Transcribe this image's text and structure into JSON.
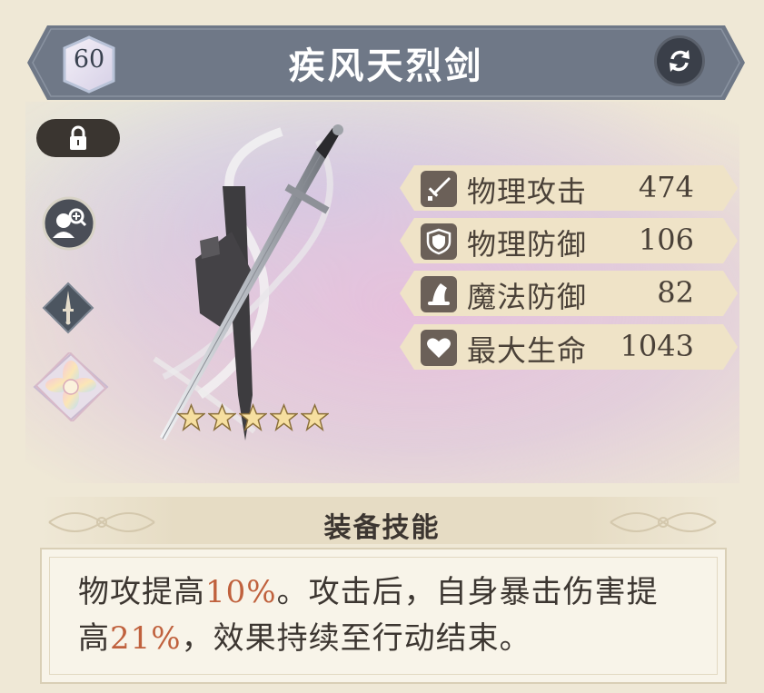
{
  "header": {
    "level": "60",
    "item_name": "疾风天烈剑",
    "swap_icon": "swap-arrows-icon"
  },
  "controls": {
    "lock_icon": "lock-icon",
    "inspect_icon": "character-search-icon",
    "type_icon": "sword-type-icon",
    "element_icon": "lotus-emblem-icon"
  },
  "weapon": {
    "star_count": 5
  },
  "stats": [
    {
      "icon": "sword-icon",
      "label": "物理攻击",
      "value": "474"
    },
    {
      "icon": "shield-icon",
      "label": "物理防御",
      "value": "106"
    },
    {
      "icon": "wizard-hat-icon",
      "label": "魔法防御",
      "value": "82"
    },
    {
      "icon": "heart-icon",
      "label": "最大生命",
      "value": "1043"
    }
  ],
  "skill": {
    "title": "装备技能",
    "line1_a": "物攻提高",
    "line1_hl": "10%",
    "line1_b": "。攻击后，自身暴击伤害提",
    "line2_a": "高",
    "line2_hl": "21%",
    "line2_b": "，效果持续至行动结束。",
    "highlight_color": "#c0613d"
  }
}
